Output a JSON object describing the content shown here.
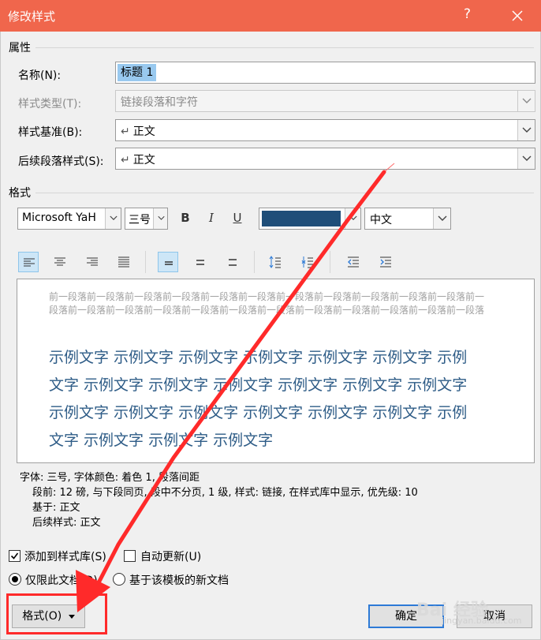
{
  "window": {
    "title": "修改样式",
    "help": "?"
  },
  "properties": {
    "section_label": "属性",
    "name_label": "名称(N):",
    "name_value": "标题 1",
    "style_type_label": "样式类型(T):",
    "style_type_value": "链接段落和字符",
    "based_on_label": "样式基准(B):",
    "based_on_value": "正文",
    "next_style_label": "后续段落样式(S):",
    "next_style_value": "正文",
    "para_mark": "↵"
  },
  "format": {
    "section_label": "格式",
    "font": "Microsoft YaH",
    "size": "三号",
    "bold": "B",
    "italic": "I",
    "underline": "U",
    "color": "#1f4e79",
    "script": "中文"
  },
  "preview": {
    "before_text": "前一段落前一段落前一段落前一段落前一段落前一段落前一段落前一段落前一段落前一段落前一段落前一段落前一段落前一段落前一段落前一段落前一段落前一段落前一段落前一段落前一段落前一段落前一段落",
    "sample_text": "示例文字 示例文字 示例文字 示例文字 示例文字 示例文字 示例文字 示例文字 示例文字 示例文字 示例文字 示例文字 示例文字 示例文字 示例文字 示例文字 示例文字 示例文字 示例文字 示例文字 示例文字 示例文字 示例文字"
  },
  "description": {
    "line1": "字体: 三号, 字体颜色: 着色 1, 段落间距",
    "line2": "段前: 12 磅, 与下段同页, 段中不分页, 1 级, 样式: 链接, 在样式库中显示, 优先级: 10",
    "line3": "基于: 正文",
    "line4": "后续样式: 正文"
  },
  "options": {
    "add_to_gallery": "添加到样式库(S)",
    "auto_update": "自动更新(U)",
    "only_this_doc": "仅限此文档(D)",
    "new_docs_template": "基于该模板的新文档"
  },
  "buttons": {
    "format": "格式(O)",
    "ok": "确定",
    "cancel": "取消"
  },
  "watermark": {
    "brand": "Bai 经验",
    "url": "jingyan.baidu.com"
  }
}
